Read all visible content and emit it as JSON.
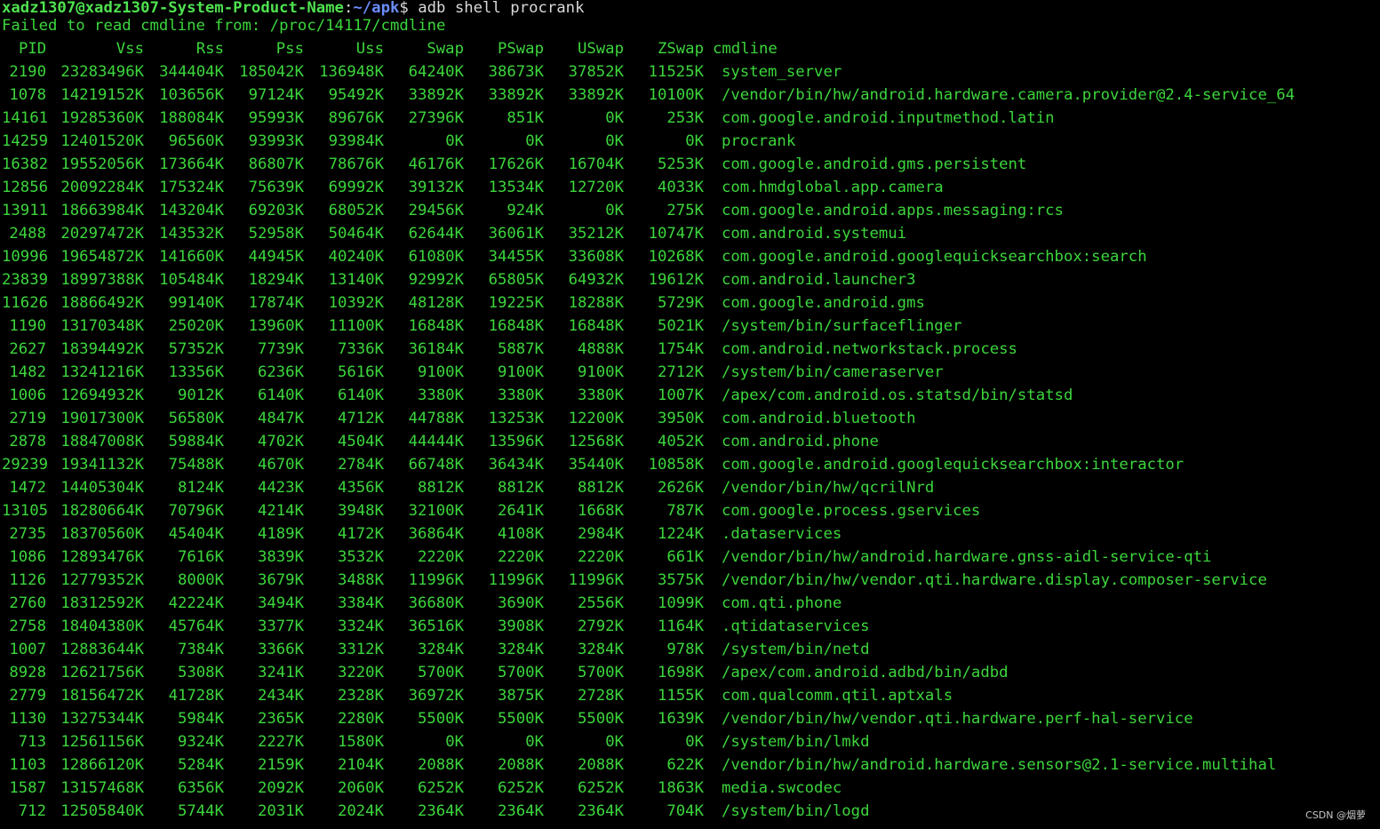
{
  "prompt": {
    "user_host": "xadz1307@xadz1307-System-Product-Name",
    "path": "~/apk",
    "symbol": "$",
    "command": " adb shell procrank"
  },
  "info_message": "Failed to read cmdline from: /proc/14117/cmdline",
  "table": {
    "headers": [
      "PID",
      "Vss",
      "Rss",
      "Pss",
      "Uss",
      "Swap",
      "PSwap",
      "USwap",
      "ZSwap",
      "cmdline"
    ],
    "rows": [
      [
        "2190",
        "23283496K",
        "344404K",
        "185042K",
        "136948K",
        "64240K",
        "38673K",
        "37852K",
        "11525K",
        "system_server"
      ],
      [
        "1078",
        "14219152K",
        "103656K",
        "97124K",
        "95492K",
        "33892K",
        "33892K",
        "33892K",
        "10100K",
        "/vendor/bin/hw/android.hardware.camera.provider@2.4-service_64"
      ],
      [
        "14161",
        "19285360K",
        "188084K",
        "95993K",
        "89676K",
        "27396K",
        "851K",
        "0K",
        "253K",
        "com.google.android.inputmethod.latin"
      ],
      [
        "14259",
        "12401520K",
        "96560K",
        "93993K",
        "93984K",
        "0K",
        "0K",
        "0K",
        "0K",
        "procrank"
      ],
      [
        "16382",
        "19552056K",
        "173664K",
        "86807K",
        "78676K",
        "46176K",
        "17626K",
        "16704K",
        "5253K",
        "com.google.android.gms.persistent"
      ],
      [
        "12856",
        "20092284K",
        "175324K",
        "75639K",
        "69992K",
        "39132K",
        "13534K",
        "12720K",
        "4033K",
        "com.hmdglobal.app.camera"
      ],
      [
        "13911",
        "18663984K",
        "143204K",
        "69203K",
        "68052K",
        "29456K",
        "924K",
        "0K",
        "275K",
        "com.google.android.apps.messaging:rcs"
      ],
      [
        "2488",
        "20297472K",
        "143532K",
        "52958K",
        "50464K",
        "62644K",
        "36061K",
        "35212K",
        "10747K",
        "com.android.systemui"
      ],
      [
        "10996",
        "19654872K",
        "141660K",
        "44945K",
        "40240K",
        "61080K",
        "34455K",
        "33608K",
        "10268K",
        "com.google.android.googlequicksearchbox:search"
      ],
      [
        "23839",
        "18997388K",
        "105484K",
        "18294K",
        "13140K",
        "92992K",
        "65805K",
        "64932K",
        "19612K",
        "com.android.launcher3"
      ],
      [
        "11626",
        "18866492K",
        "99140K",
        "17874K",
        "10392K",
        "48128K",
        "19225K",
        "18288K",
        "5729K",
        "com.google.android.gms"
      ],
      [
        "1190",
        "13170348K",
        "25020K",
        "13960K",
        "11100K",
        "16848K",
        "16848K",
        "16848K",
        "5021K",
        "/system/bin/surfaceflinger"
      ],
      [
        "2627",
        "18394492K",
        "57352K",
        "7739K",
        "7336K",
        "36184K",
        "5887K",
        "4888K",
        "1754K",
        "com.android.networkstack.process"
      ],
      [
        "1482",
        "13241216K",
        "13356K",
        "6236K",
        "5616K",
        "9100K",
        "9100K",
        "9100K",
        "2712K",
        "/system/bin/cameraserver"
      ],
      [
        "1006",
        "12694932K",
        "9012K",
        "6140K",
        "6140K",
        "3380K",
        "3380K",
        "3380K",
        "1007K",
        "/apex/com.android.os.statsd/bin/statsd"
      ],
      [
        "2719",
        "19017300K",
        "56580K",
        "4847K",
        "4712K",
        "44788K",
        "13253K",
        "12200K",
        "3950K",
        "com.android.bluetooth"
      ],
      [
        "2878",
        "18847008K",
        "59884K",
        "4702K",
        "4504K",
        "44444K",
        "13596K",
        "12568K",
        "4052K",
        "com.android.phone"
      ],
      [
        "29239",
        "19341132K",
        "75488K",
        "4670K",
        "2784K",
        "66748K",
        "36434K",
        "35440K",
        "10858K",
        "com.google.android.googlequicksearchbox:interactor"
      ],
      [
        "1472",
        "14405304K",
        "8124K",
        "4423K",
        "4356K",
        "8812K",
        "8812K",
        "8812K",
        "2626K",
        "/vendor/bin/hw/qcrilNrd"
      ],
      [
        "13105",
        "18280664K",
        "70796K",
        "4214K",
        "3948K",
        "32100K",
        "2641K",
        "1668K",
        "787K",
        "com.google.process.gservices"
      ],
      [
        "2735",
        "18370560K",
        "45404K",
        "4189K",
        "4172K",
        "36864K",
        "4108K",
        "2984K",
        "1224K",
        ".dataservices"
      ],
      [
        "1086",
        "12893476K",
        "7616K",
        "3839K",
        "3532K",
        "2220K",
        "2220K",
        "2220K",
        "661K",
        "/vendor/bin/hw/android.hardware.gnss-aidl-service-qti"
      ],
      [
        "1126",
        "12779352K",
        "8000K",
        "3679K",
        "3488K",
        "11996K",
        "11996K",
        "11996K",
        "3575K",
        "/vendor/bin/hw/vendor.qti.hardware.display.composer-service"
      ],
      [
        "2760",
        "18312592K",
        "42224K",
        "3494K",
        "3384K",
        "36680K",
        "3690K",
        "2556K",
        "1099K",
        "com.qti.phone"
      ],
      [
        "2758",
        "18404380K",
        "45764K",
        "3377K",
        "3324K",
        "36516K",
        "3908K",
        "2792K",
        "1164K",
        ".qtidataservices"
      ],
      [
        "1007",
        "12883644K",
        "7384K",
        "3366K",
        "3312K",
        "3284K",
        "3284K",
        "3284K",
        "978K",
        "/system/bin/netd"
      ],
      [
        "8928",
        "12621756K",
        "5308K",
        "3241K",
        "3220K",
        "5700K",
        "5700K",
        "5700K",
        "1698K",
        "/apex/com.android.adbd/bin/adbd"
      ],
      [
        "2779",
        "18156472K",
        "41728K",
        "2434K",
        "2328K",
        "36972K",
        "3875K",
        "2728K",
        "1155K",
        "com.qualcomm.qtil.aptxals"
      ],
      [
        "1130",
        "13275344K",
        "5984K",
        "2365K",
        "2280K",
        "5500K",
        "5500K",
        "5500K",
        "1639K",
        "/vendor/bin/hw/vendor.qti.hardware.perf-hal-service"
      ],
      [
        "713",
        "12561156K",
        "9324K",
        "2227K",
        "1580K",
        "0K",
        "0K",
        "0K",
        "0K",
        "/system/bin/lmkd"
      ],
      [
        "1103",
        "12866120K",
        "5284K",
        "2159K",
        "2104K",
        "2088K",
        "2088K",
        "2088K",
        "622K",
        "/vendor/bin/hw/android.hardware.sensors@2.1-service.multihal"
      ],
      [
        "1587",
        "13157468K",
        "6356K",
        "2092K",
        "2060K",
        "6252K",
        "6252K",
        "6252K",
        "1863K",
        "media.swcodec"
      ],
      [
        "712",
        "12505840K",
        "5744K",
        "2031K",
        "2024K",
        "2364K",
        "2364K",
        "2364K",
        "704K",
        "/system/bin/logd"
      ]
    ]
  },
  "watermark": "CSDN @烟萝",
  "colors": {
    "background": "#000000",
    "text": "#3cd63c",
    "user_host": "#4fe24f",
    "path": "#6b8dff"
  }
}
